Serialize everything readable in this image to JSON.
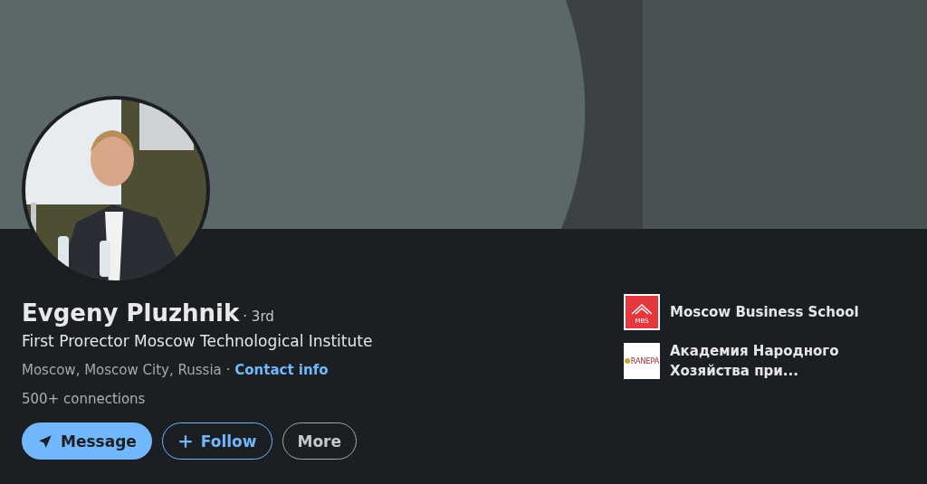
{
  "profile": {
    "name": "Evgeny Pluzhnik",
    "degree": "· 3rd",
    "headline": "First Prorector Moscow Technological Institute",
    "location": "Moscow, Moscow City, Russia ·",
    "contact_link": "Contact info",
    "connections": "500+ connections"
  },
  "actions": [
    {
      "kind": "primary",
      "label": "Message"
    },
    {
      "kind": "outline",
      "label": "Follow"
    },
    {
      "kind": "neutral",
      "label": "More"
    }
  ],
  "education": [
    {
      "name": "Moscow Business School",
      "logo_text": "MBS",
      "kind": "mbs"
    },
    {
      "name": "Академия Народного Хозяйства при...",
      "logo_text": "RANEPA",
      "kind": "ranepa"
    }
  ]
}
